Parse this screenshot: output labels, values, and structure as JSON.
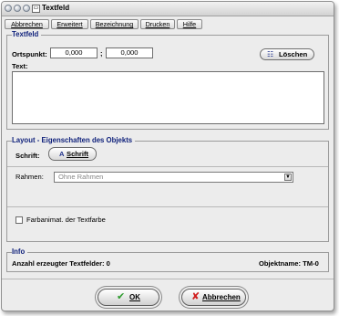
{
  "window": {
    "title": "Textfeld"
  },
  "menu": [
    "Abbrechen",
    "Erweitert",
    "Bezeichnung",
    "Drucken",
    "Hilfe"
  ],
  "textfeld": {
    "title": "Textfeld",
    "ortspunkt_label": "Ortspunkt:",
    "x_value": "0,000",
    "separator": ";",
    "y_value": "0,000",
    "text_label": "Text:",
    "clear_button": "Löschen"
  },
  "layout": {
    "title": "Layout - Eigenschaften des Objekts",
    "font_label": "Schrift:",
    "font_button": "Schrift",
    "font_button_glyph": "A",
    "frame_label": "Rahmen:",
    "frame_value": "Ohne Rahmen",
    "color_anim_label": "Farbanimat. der Textfarbe",
    "color_anim_checked": false
  },
  "info": {
    "title": "Info",
    "count_label": "Anzahl erzeugter Textfelder: 0",
    "name_label": "Objektname:  TM-0"
  },
  "footer": {
    "ok": "OK",
    "cancel": "Abbrechen"
  },
  "colors": {
    "group_title": "#0d1f7a",
    "ok_icon": "#2e9b2e",
    "cancel_icon": "#d11c1c"
  }
}
